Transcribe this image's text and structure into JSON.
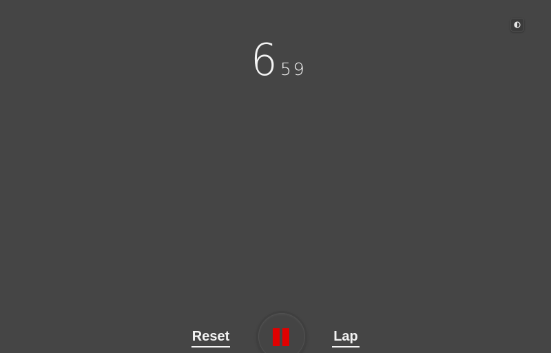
{
  "theme_toggle": {
    "icon": "contrast-icon"
  },
  "timer": {
    "seconds": "6",
    "hundredths": "59"
  },
  "controls": {
    "reset_label": "Reset",
    "lap_label": "Lap",
    "pause_icon": "pause-icon"
  },
  "colors": {
    "background": "#454545",
    "text": "#f4f4f4",
    "pause_accent": "#e10000"
  }
}
